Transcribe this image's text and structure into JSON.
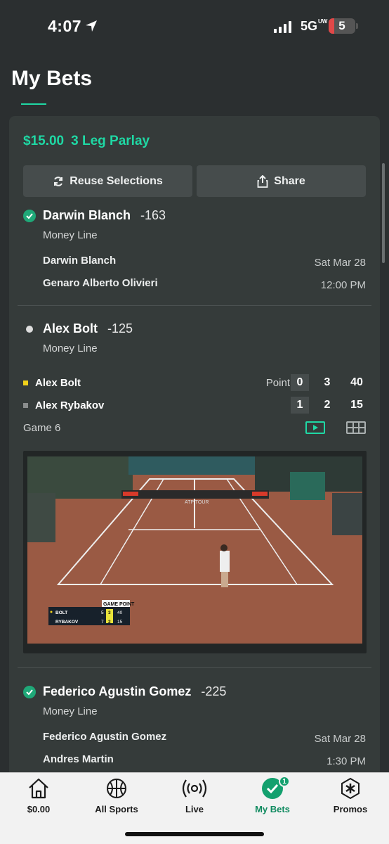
{
  "status_bar": {
    "time": "4:07",
    "network": "5G",
    "network_sup": "UW",
    "battery": "5"
  },
  "page_title": "My Bets",
  "bet": {
    "stake": "$15.00",
    "type": "3 Leg Parlay",
    "reuse_label": "Reuse Selections",
    "share_label": "Share"
  },
  "legs": [
    {
      "selection": "Darwin Blanch",
      "odds": "-163",
      "market": "Money Line",
      "player1": "Darwin Blanch",
      "player2": "Genaro Alberto Olivieri",
      "date": "Sat Mar 28",
      "time": "12:00 PM",
      "status": "won"
    },
    {
      "selection": "Alex Bolt",
      "odds": "-125",
      "market": "Money Line",
      "status": "live",
      "score_label": "Point",
      "game_label": "Game 6",
      "scoreboard": [
        {
          "player": "Alex Bolt",
          "marker_color": "#f1d21a",
          "sets": "0",
          "games": "3",
          "points": "40"
        },
        {
          "player": "Alex Rybakov",
          "marker_color": "#8a8d8d",
          "sets": "1",
          "games": "2",
          "points": "15"
        }
      ],
      "video": {
        "banner_label": "GAME POINT",
        "rows": [
          {
            "name": "BOLT",
            "set": "5",
            "game": "3",
            "point": "40"
          },
          {
            "name": "RYBAKOV",
            "set": "7",
            "game": "2",
            "point": "15"
          }
        ],
        "court_text": "ATP TOUR"
      }
    },
    {
      "selection": "Federico Agustin Gomez",
      "odds": "-225",
      "market": "Money Line",
      "player1": "Federico Agustin Gomez",
      "player2": "Andres Martin",
      "date": "Sat Mar 28",
      "time": "1:30 PM",
      "status": "won"
    }
  ],
  "tabbar": [
    {
      "label": "$0.00",
      "icon": "home-icon"
    },
    {
      "label": "All Sports",
      "icon": "basketball-icon"
    },
    {
      "label": "Live",
      "icon": "broadcast-icon"
    },
    {
      "label": "My Bets",
      "icon": "check-circle-icon",
      "badge": "1",
      "active": true
    },
    {
      "label": "Promos",
      "icon": "star-badge-icon"
    }
  ],
  "colors": {
    "accent": "#1fd8a4",
    "card": "#353b3a",
    "background": "#2b2f30",
    "court": "#9a5a44"
  }
}
